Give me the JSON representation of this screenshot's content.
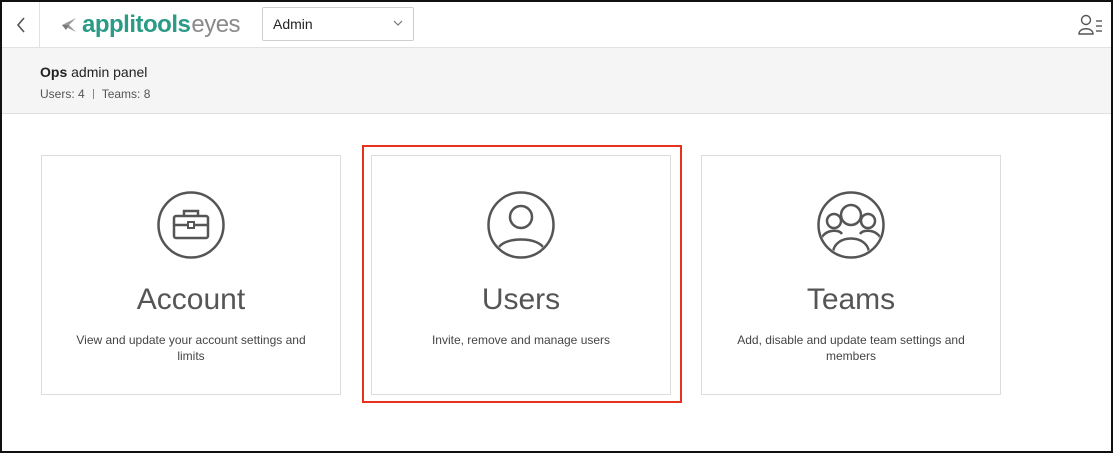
{
  "header": {
    "logo_primary": "applitools",
    "logo_secondary": "eyes",
    "role_select": {
      "value": "Admin"
    }
  },
  "panel": {
    "title_bold": "Ops",
    "title_rest": " admin panel",
    "users_stat": "Users: 4",
    "teams_stat": "Teams: 8"
  },
  "cards": [
    {
      "title": "Account",
      "description": "View and update your account settings and limits",
      "icon": "briefcase-icon"
    },
    {
      "title": "Users",
      "description": "Invite, remove and manage users",
      "icon": "user-icon"
    },
    {
      "title": "Teams",
      "description": "Add, disable and update team settings and members",
      "icon": "team-icon"
    }
  ],
  "colors": {
    "brand": "#2b9a86",
    "highlight": "#e8321e",
    "icon_stroke": "#555555"
  }
}
